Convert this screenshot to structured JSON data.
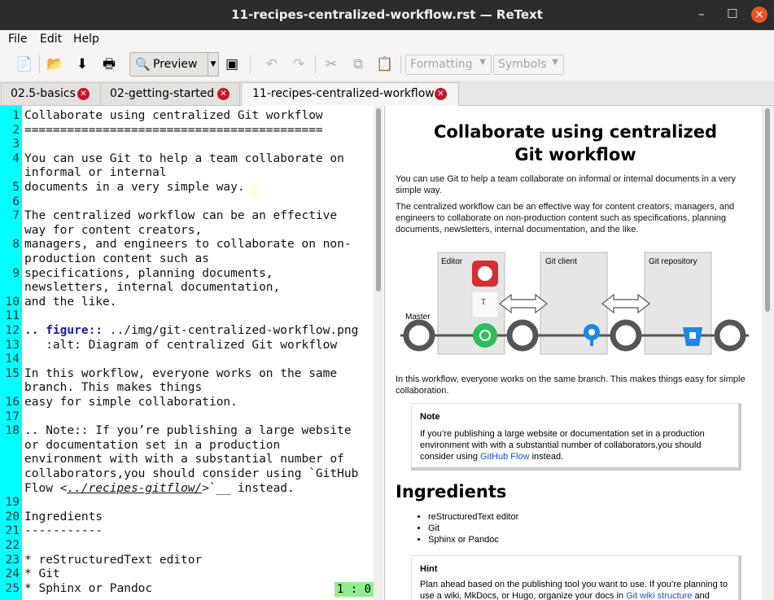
{
  "window": {
    "title": "11-recipes-centralized-workflow.rst — ReText",
    "min": "–",
    "max": "☐",
    "close": "×"
  },
  "menu": [
    "File",
    "Edit",
    "Help"
  ],
  "toolbar": {
    "preview_label": "Preview",
    "formatting": "Formatting",
    "symbols": "Symbols"
  },
  "tabs": [
    {
      "label": "02.5-basics"
    },
    {
      "label": "02-getting-started"
    },
    {
      "label": "11-recipes-centralized-workflow",
      "active": true
    }
  ],
  "editor": {
    "line_numbers": [
      "1",
      "2",
      "3",
      "4",
      "",
      "5",
      "6",
      "7",
      "",
      "8",
      "",
      "9",
      "",
      "10",
      "11",
      "12",
      "13",
      "14",
      "15",
      "",
      "16",
      "17",
      "18",
      "",
      "",
      "",
      "",
      "19",
      "20",
      "21",
      "22",
      "23",
      "24",
      "25"
    ],
    "lines": [
      "Collaborate using centralized Git workflow",
      "==========================================",
      "",
      "You can use Git to help a team collaborate on",
      "informal or internal",
      "documents in a very simple way.",
      "",
      "The centralized workflow can be an effective",
      "way for content creators,",
      "managers, and engineers to collaborate on non-",
      "production content such as",
      "specifications, planning documents,",
      "newsletters, internal documentation,",
      "and the like.",
      "",
      ".. figure:: ../img/git-centralized-workflow.png",
      "   :alt: Diagram of centralized Git workflow",
      "",
      "In this workflow, everyone works on the same",
      "branch. This makes things",
      "easy for simple collaboration.",
      "",
      ".. Note:: If you’re publishing a large website",
      "or documentation set in a production",
      "environment with with a substantial number of",
      "collaborators,you should consider using `GitHub",
      "Flow <../recipes-gitflow/>`__ instead.",
      "",
      "Ingredients",
      "-----------",
      "",
      "* reStructuredText editor",
      "* Git",
      "* Sphinx or Pandoc"
    ],
    "position": "1 : 0"
  },
  "preview": {
    "title": "Collaborate using centralized Git workflow",
    "p1": "You can use Git to help a team collaborate on informal or internal documents in a very simple way.",
    "p2": "The centralized workflow can be an effective way for content creators, managers, and engineers to collaborate on non-production content such as specifications, planning documents, newsletters, internal documentation, and the like.",
    "diagram": {
      "editor": "Editor",
      "git_client": "Git client",
      "git_repository": "Git repository",
      "master": "Master"
    },
    "p3": "In this workflow, everyone works on the same branch. This makes things easy for simple collaboration.",
    "note_title": "Note",
    "note_text": "If you’re publishing a large website or documentation set in a production environment with with a substantial number of collaborators,you should consider using ",
    "note_link": "GitHub Flow",
    "note_tail": " instead.",
    "ingredients_title": "Ingredients",
    "ingredients": [
      "reStructuredText editor",
      "Git",
      "Sphinx or Pandoc"
    ],
    "hint_title": "Hint",
    "hint_text": "Plan ahead based on the publishing tool you want to use. If you’re planning to use a wiki, MkDocs, or Hugo, organize your docs in ",
    "hint_link": "Git wiki structure",
    "hint_tail": " and"
  }
}
